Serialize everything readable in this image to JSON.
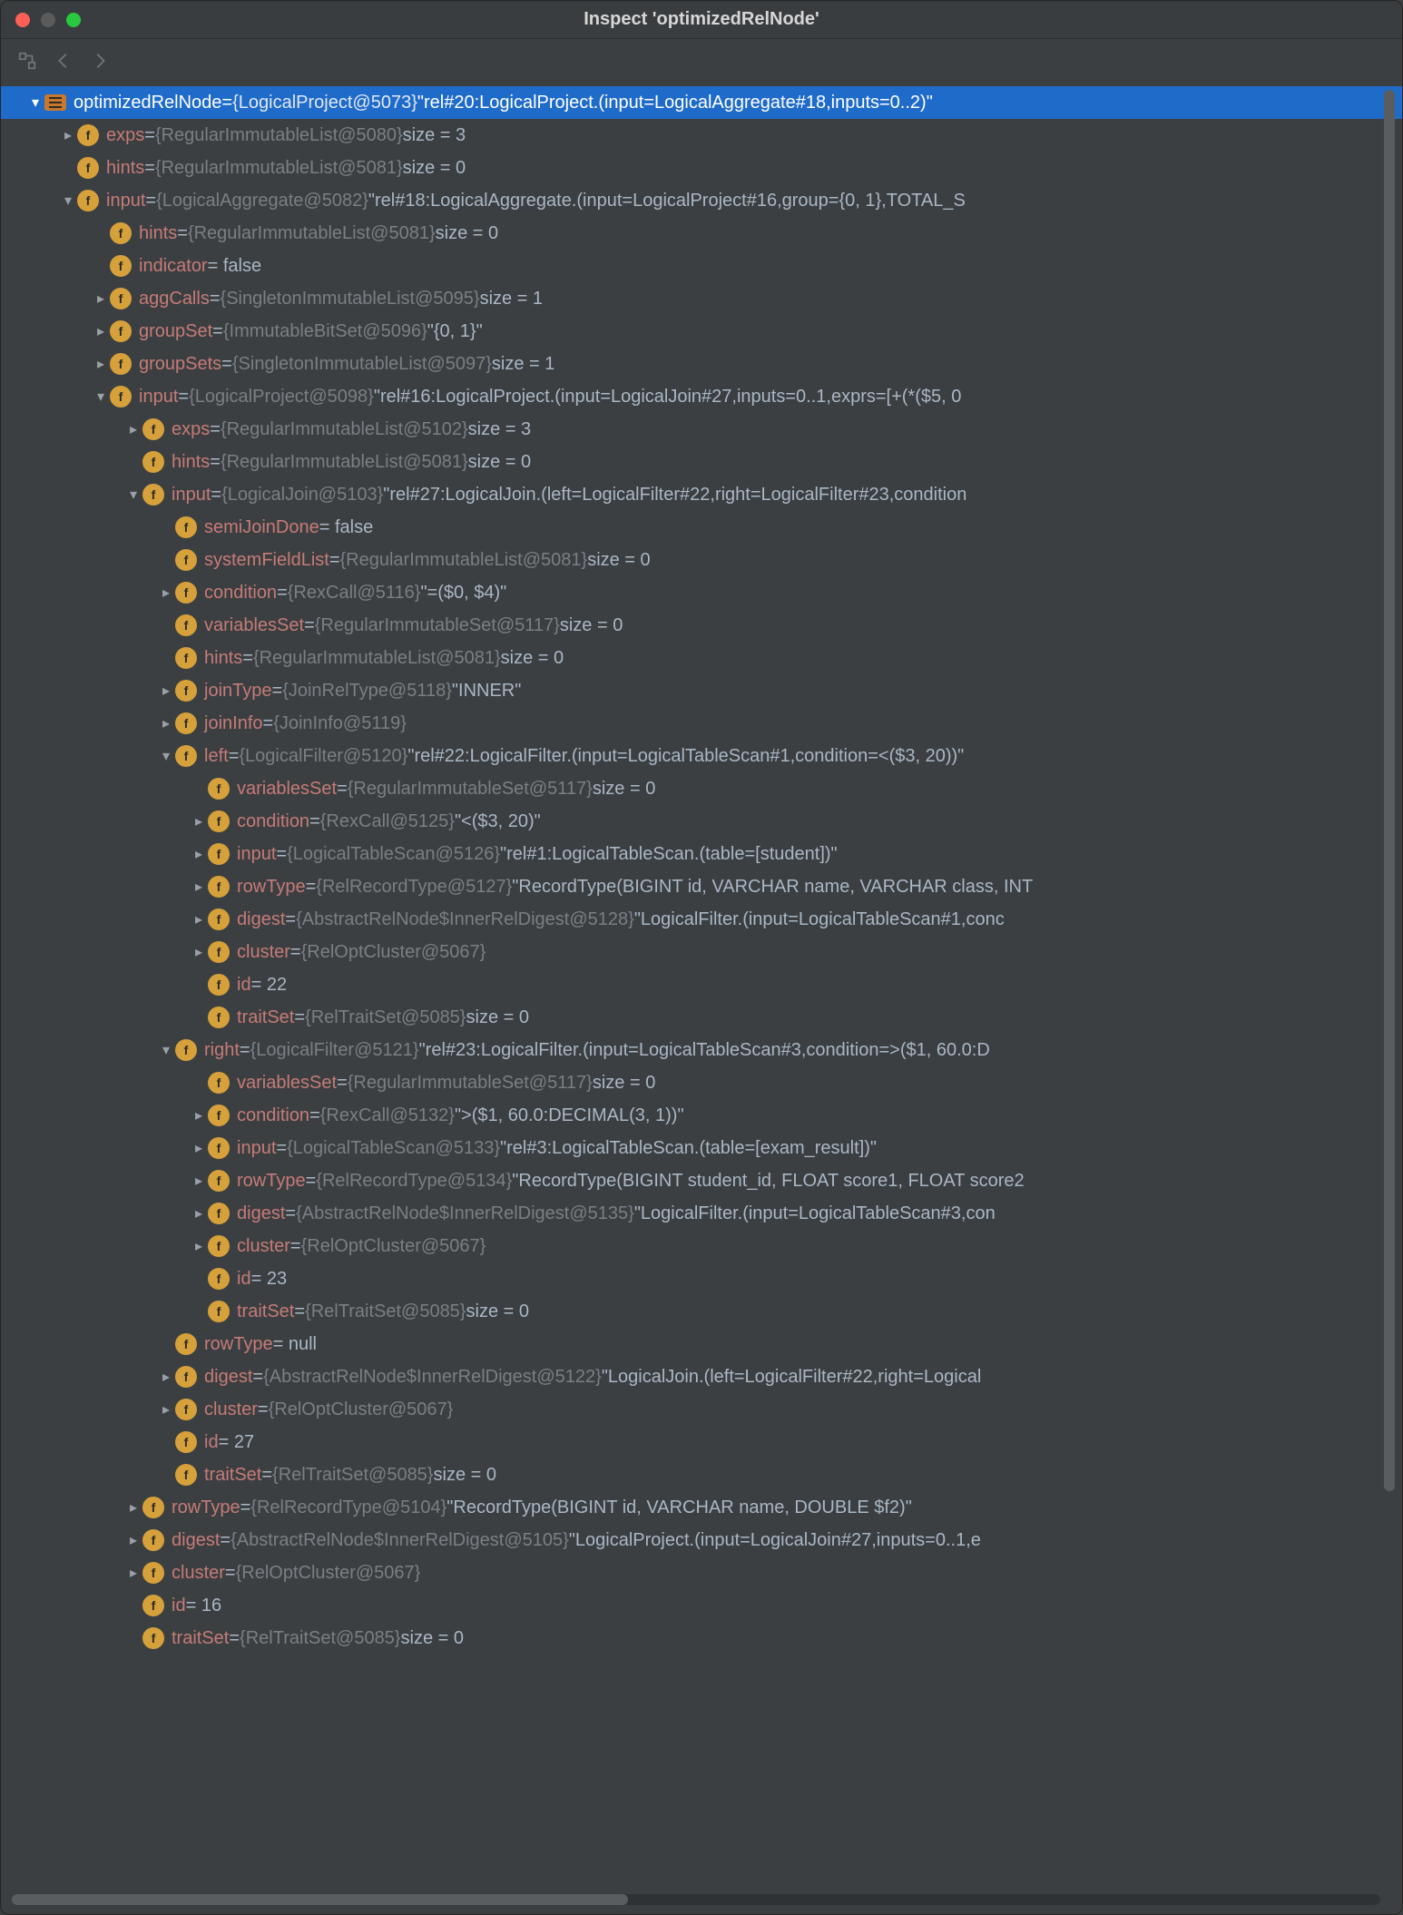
{
  "window": {
    "title": "Inspect 'optimizedRelNode'"
  },
  "rows": [
    {
      "depth": 0,
      "arrow": "down",
      "icon": "list",
      "name": "optimizedRelNode",
      "obj": "{LogicalProject@5073}",
      "str": "\"rel#20:LogicalProject.(input=LogicalAggregate#18,inputs=0..2)\"",
      "selected": true
    },
    {
      "depth": 1,
      "arrow": "right",
      "icon": "f",
      "lock": true,
      "name": "exps",
      "obj": "{RegularImmutableList@5080}",
      "str": " size = 3"
    },
    {
      "depth": 1,
      "arrow": "none",
      "icon": "f",
      "lock": true,
      "name": "hints",
      "obj": "{RegularImmutableList@5081}",
      "str": " size = 0"
    },
    {
      "depth": 1,
      "arrow": "down",
      "icon": "f",
      "lock": true,
      "name": "input",
      "obj": "{LogicalAggregate@5082}",
      "str": "\"rel#18:LogicalAggregate.(input=LogicalProject#16,group={0, 1},TOTAL_S"
    },
    {
      "depth": 2,
      "arrow": "none",
      "icon": "f",
      "lock": true,
      "name": "hints",
      "obj": "{RegularImmutableList@5081}",
      "str": " size = 0"
    },
    {
      "depth": 2,
      "arrow": "none",
      "icon": "f",
      "lock": true,
      "name": "indicator",
      "obj": "",
      "str": "= false"
    },
    {
      "depth": 2,
      "arrow": "right",
      "icon": "f",
      "lock": true,
      "name": "aggCalls",
      "obj": "{SingletonImmutableList@5095}",
      "str": " size = 1"
    },
    {
      "depth": 2,
      "arrow": "right",
      "icon": "f",
      "lock": true,
      "name": "groupSet",
      "obj": "{ImmutableBitSet@5096}",
      "str": "\"{0, 1}\""
    },
    {
      "depth": 2,
      "arrow": "right",
      "icon": "f",
      "lock": true,
      "name": "groupSets",
      "obj": "{SingletonImmutableList@5097}",
      "str": " size = 1"
    },
    {
      "depth": 2,
      "arrow": "down",
      "icon": "f",
      "name": "input",
      "obj": "{LogicalProject@5098}",
      "str": "\"rel#16:LogicalProject.(input=LogicalJoin#27,inputs=0..1,exprs=[+(*($5, 0"
    },
    {
      "depth": 3,
      "arrow": "right",
      "icon": "f",
      "lock": true,
      "name": "exps",
      "obj": "{RegularImmutableList@5102}",
      "str": " size = 3"
    },
    {
      "depth": 3,
      "arrow": "none",
      "icon": "f",
      "lock": true,
      "name": "hints",
      "obj": "{RegularImmutableList@5081}",
      "str": " size = 0"
    },
    {
      "depth": 3,
      "arrow": "down",
      "icon": "f",
      "lock": true,
      "name": "input",
      "obj": "{LogicalJoin@5103}",
      "str": "\"rel#27:LogicalJoin.(left=LogicalFilter#22,right=LogicalFilter#23,condition"
    },
    {
      "depth": 4,
      "arrow": "none",
      "icon": "f",
      "lock": true,
      "name": "semiJoinDone",
      "obj": "",
      "str": "= false"
    },
    {
      "depth": 4,
      "arrow": "none",
      "icon": "f",
      "lock": true,
      "name": "systemFieldList",
      "obj": "{RegularImmutableList@5081}",
      "str": " size = 0"
    },
    {
      "depth": 4,
      "arrow": "right",
      "icon": "f",
      "lock": true,
      "name": "condition",
      "obj": "{RexCall@5116}",
      "str": "\"=($0, $4)\""
    },
    {
      "depth": 4,
      "arrow": "none",
      "icon": "f",
      "lock": true,
      "name": "variablesSet",
      "obj": "{RegularImmutableSet@5117}",
      "str": " size = 0"
    },
    {
      "depth": 4,
      "arrow": "none",
      "icon": "f",
      "lock": true,
      "name": "hints",
      "obj": "{RegularImmutableList@5081}",
      "str": " size = 0"
    },
    {
      "depth": 4,
      "arrow": "right",
      "icon": "f",
      "lock": true,
      "name": "joinType",
      "obj": "{JoinRelType@5118}",
      "str": "\"INNER\""
    },
    {
      "depth": 4,
      "arrow": "right",
      "icon": "f",
      "lock": true,
      "name": "joinInfo",
      "obj": "{JoinInfo@5119}",
      "str": ""
    },
    {
      "depth": 4,
      "arrow": "down",
      "icon": "f",
      "name": "left",
      "obj": "{LogicalFilter@5120}",
      "str": "\"rel#22:LogicalFilter.(input=LogicalTableScan#1,condition=<($3, 20))\""
    },
    {
      "depth": 5,
      "arrow": "none",
      "icon": "f",
      "lock": true,
      "name": "variablesSet",
      "obj": "{RegularImmutableSet@5117}",
      "str": " size = 0"
    },
    {
      "depth": 5,
      "arrow": "right",
      "icon": "f",
      "lock": true,
      "name": "condition",
      "obj": "{RexCall@5125}",
      "str": "\"<($3, 20)\""
    },
    {
      "depth": 5,
      "arrow": "right",
      "icon": "f",
      "name": "input",
      "obj": "{LogicalTableScan@5126}",
      "str": "\"rel#1:LogicalTableScan.(table=[student])\""
    },
    {
      "depth": 5,
      "arrow": "right",
      "icon": "f",
      "name": "rowType",
      "obj": "{RelRecordType@5127}",
      "str": "\"RecordType(BIGINT id, VARCHAR name, VARCHAR class, INT"
    },
    {
      "depth": 5,
      "arrow": "right",
      "icon": "f",
      "name": "digest",
      "obj": "{AbstractRelNode$InnerRelDigest@5128}",
      "str": "\"LogicalFilter.(input=LogicalTableScan#1,conc"
    },
    {
      "depth": 5,
      "arrow": "right",
      "icon": "f",
      "lock": true,
      "name": "cluster",
      "obj": "{RelOptCluster@5067}",
      "str": ""
    },
    {
      "depth": 5,
      "arrow": "none",
      "icon": "f",
      "lock": true,
      "name": "id",
      "obj": "",
      "str": "= 22"
    },
    {
      "depth": 5,
      "arrow": "none",
      "icon": "f",
      "name": "traitSet",
      "obj": "{RelTraitSet@5085}",
      "str": " size = 0"
    },
    {
      "depth": 4,
      "arrow": "down",
      "icon": "f",
      "name": "right",
      "obj": "{LogicalFilter@5121}",
      "str": "\"rel#23:LogicalFilter.(input=LogicalTableScan#3,condition=>($1, 60.0:D"
    },
    {
      "depth": 5,
      "arrow": "none",
      "icon": "f",
      "lock": true,
      "name": "variablesSet",
      "obj": "{RegularImmutableSet@5117}",
      "str": " size = 0"
    },
    {
      "depth": 5,
      "arrow": "right",
      "icon": "f",
      "lock": true,
      "name": "condition",
      "obj": "{RexCall@5132}",
      "str": "\">($1, 60.0:DECIMAL(3, 1))\""
    },
    {
      "depth": 5,
      "arrow": "right",
      "icon": "f",
      "name": "input",
      "obj": "{LogicalTableScan@5133}",
      "str": "\"rel#3:LogicalTableScan.(table=[exam_result])\""
    },
    {
      "depth": 5,
      "arrow": "right",
      "icon": "f",
      "name": "rowType",
      "obj": "{RelRecordType@5134}",
      "str": "\"RecordType(BIGINT student_id, FLOAT score1, FLOAT score2"
    },
    {
      "depth": 5,
      "arrow": "right",
      "icon": "f",
      "name": "digest",
      "obj": "{AbstractRelNode$InnerRelDigest@5135}",
      "str": "\"LogicalFilter.(input=LogicalTableScan#3,con"
    },
    {
      "depth": 5,
      "arrow": "right",
      "icon": "f",
      "lock": true,
      "name": "cluster",
      "obj": "{RelOptCluster@5067}",
      "str": ""
    },
    {
      "depth": 5,
      "arrow": "none",
      "icon": "f",
      "lock": true,
      "name": "id",
      "obj": "",
      "str": "= 23"
    },
    {
      "depth": 5,
      "arrow": "none",
      "icon": "f",
      "name": "traitSet",
      "obj": "{RelTraitSet@5085}",
      "str": " size = 0"
    },
    {
      "depth": 4,
      "arrow": "none",
      "icon": "f",
      "name": "rowType",
      "obj": "",
      "str": "= null"
    },
    {
      "depth": 4,
      "arrow": "right",
      "icon": "f",
      "name": "digest",
      "obj": "{AbstractRelNode$InnerRelDigest@5122}",
      "str": "\"LogicalJoin.(left=LogicalFilter#22,right=Logical"
    },
    {
      "depth": 4,
      "arrow": "right",
      "icon": "f",
      "lock": true,
      "name": "cluster",
      "obj": "{RelOptCluster@5067}",
      "str": ""
    },
    {
      "depth": 4,
      "arrow": "none",
      "icon": "f",
      "lock": true,
      "name": "id",
      "obj": "",
      "str": "= 27"
    },
    {
      "depth": 4,
      "arrow": "none",
      "icon": "f",
      "name": "traitSet",
      "obj": "{RelTraitSet@5085}",
      "str": " size = 0"
    },
    {
      "depth": 3,
      "arrow": "right",
      "icon": "f",
      "name": "rowType",
      "obj": "{RelRecordType@5104}",
      "str": "\"RecordType(BIGINT id, VARCHAR name, DOUBLE $f2)\""
    },
    {
      "depth": 3,
      "arrow": "right",
      "icon": "f",
      "name": "digest",
      "obj": "{AbstractRelNode$InnerRelDigest@5105}",
      "str": "\"LogicalProject.(input=LogicalJoin#27,inputs=0..1,e"
    },
    {
      "depth": 3,
      "arrow": "right",
      "icon": "f",
      "lock": true,
      "name": "cluster",
      "obj": "{RelOptCluster@5067}",
      "str": ""
    },
    {
      "depth": 3,
      "arrow": "none",
      "icon": "f",
      "lock": true,
      "name": "id",
      "obj": "",
      "str": "= 16"
    },
    {
      "depth": 3,
      "arrow": "none",
      "icon": "f",
      "name": "traitSet",
      "obj": "{RelTraitSet@5085}",
      "str": " size = 0"
    }
  ]
}
